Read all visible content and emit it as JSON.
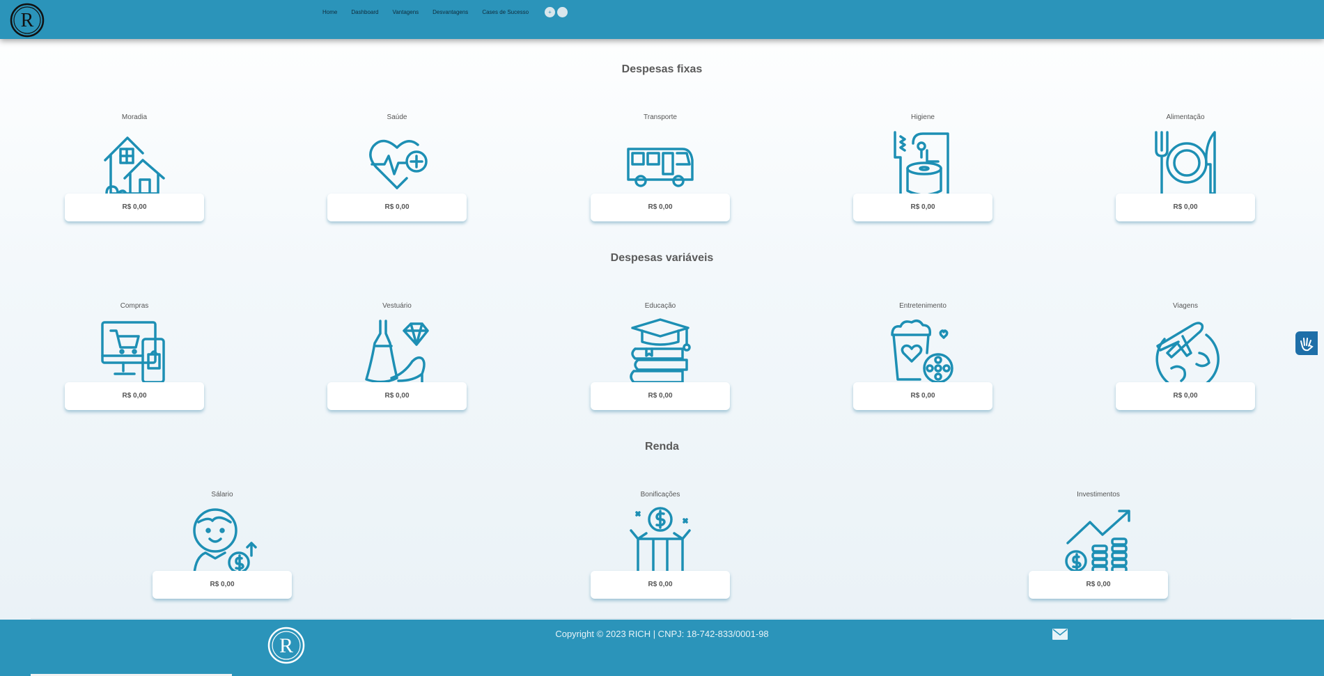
{
  "header": {
    "logo_letter": "R",
    "nav": [
      "Home",
      "Dashboard",
      "Vantagens",
      "Desvantagens",
      "Cases de Sucesso"
    ],
    "zoom_in_label": "+",
    "zoom_out_label": ""
  },
  "sections": {
    "fixed": {
      "title": "Despesas fixas",
      "items": [
        {
          "label": "Moradia",
          "value": "R$ 0,00",
          "icon": "house-icon"
        },
        {
          "label": "Saúde",
          "value": "R$ 0,00",
          "icon": "heart-health-icon"
        },
        {
          "label": "Transporte",
          "value": "R$ 0,00",
          "icon": "bus-icon"
        },
        {
          "label": "Higiene",
          "value": "R$ 0,00",
          "icon": "hygiene-icon"
        },
        {
          "label": "Alimentação",
          "value": "R$ 0,00",
          "icon": "plate-cutlery-icon"
        }
      ]
    },
    "variable": {
      "title": "Despesas variáveis",
      "items": [
        {
          "label": "Compras",
          "value": "R$ 0,00",
          "icon": "shopping-icon"
        },
        {
          "label": "Vestuário",
          "value": "R$ 0,00",
          "icon": "dress-icon"
        },
        {
          "label": "Educação",
          "value": "R$ 0,00",
          "icon": "books-graduation-icon"
        },
        {
          "label": "Entretenimento",
          "value": "R$ 0,00",
          "icon": "popcorn-film-icon"
        },
        {
          "label": "Viagens",
          "value": "R$ 0,00",
          "icon": "plane-globe-icon"
        }
      ]
    },
    "income": {
      "title": "Renda",
      "items": [
        {
          "label": "Sálario",
          "value": "R$ 0,00",
          "icon": "person-money-icon"
        },
        {
          "label": "Bonificações",
          "value": "R$ 0,00",
          "icon": "gift-money-icon"
        },
        {
          "label": "Investimentos",
          "value": "R$ 0,00",
          "icon": "growth-chart-icon"
        }
      ]
    }
  },
  "footer": {
    "copyright": "Copyright © 2023 RICH | CNPJ: 18-742-833/0001-98",
    "logo_letter": "R"
  },
  "colors": {
    "primary": "#2b94ba",
    "icon": "#1d8fb4"
  }
}
